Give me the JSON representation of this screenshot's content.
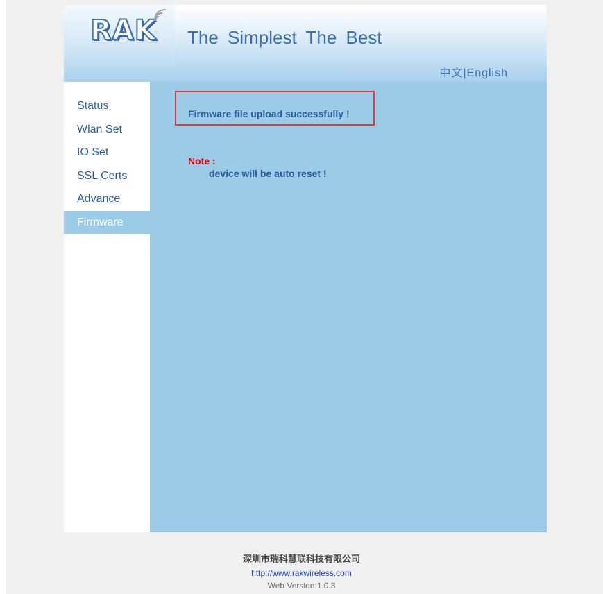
{
  "header": {
    "logo_text": "RAK",
    "tagline": "The  Simplest  The  Best",
    "lang_cn": "中文",
    "lang_sep": "|",
    "lang_en": "English"
  },
  "sidebar": {
    "items": [
      {
        "label": "Status"
      },
      {
        "label": "Wlan Set"
      },
      {
        "label": "IO Set"
      },
      {
        "label": "SSL Certs"
      },
      {
        "label": "Advance"
      },
      {
        "label": "Firmware",
        "active": true
      }
    ]
  },
  "main": {
    "message": "Firmware file upload successfully !",
    "note_label": "Note :",
    "note_text": "device will be auto reset !"
  },
  "footer": {
    "company": "深圳市瑞科慧联科技有限公司",
    "url": "http://www.rakwireless.com",
    "version": "Web Version:1.0.3"
  },
  "colors": {
    "brand_blue": "#3a6fb4",
    "content_bg": "#9ccbe8",
    "highlight_border": "#e0393e",
    "note_red": "#e00000"
  }
}
